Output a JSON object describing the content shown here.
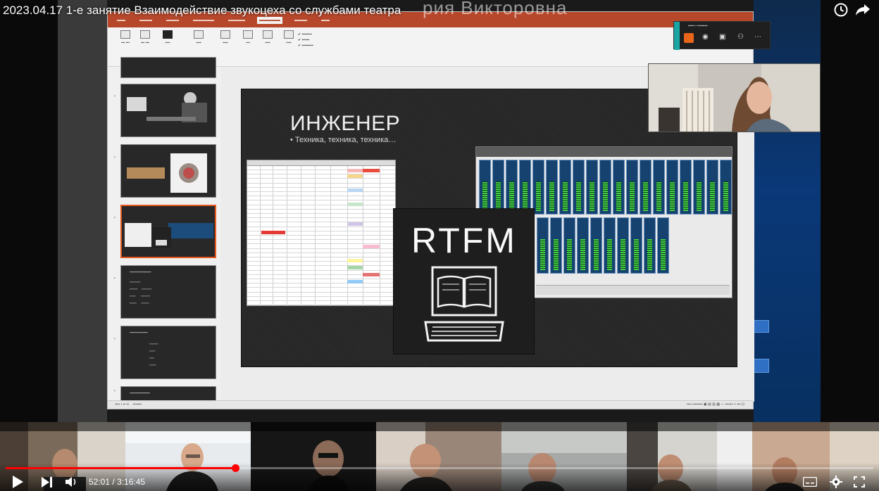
{
  "video": {
    "title": "2023.04.17 1-е занятие Взаимодействие звукоцеха со службами театра",
    "overlay_name": "рия Викторовна",
    "time_current": "52:01",
    "time_total": "3:16:45",
    "progress": 0.2646
  },
  "slide": {
    "title": "ИНЖЕНЕР",
    "bullet": "• Техника, техника, техника…",
    "badge": "RTFM"
  },
  "colors": {
    "player_accent": "#ff0000",
    "ppt_ribbon": "#b7472a",
    "selection": "#e5571e",
    "teams_share": "#e8651a",
    "meter_green": "#44d044"
  },
  "icons": [
    "play-icon",
    "next-icon",
    "volume-icon",
    "subtitles-icon",
    "gear-icon",
    "fullscreen-icon",
    "clock-icon",
    "share-icon",
    "laptop-book-icon",
    "screen-share-icon",
    "more-icon"
  ]
}
